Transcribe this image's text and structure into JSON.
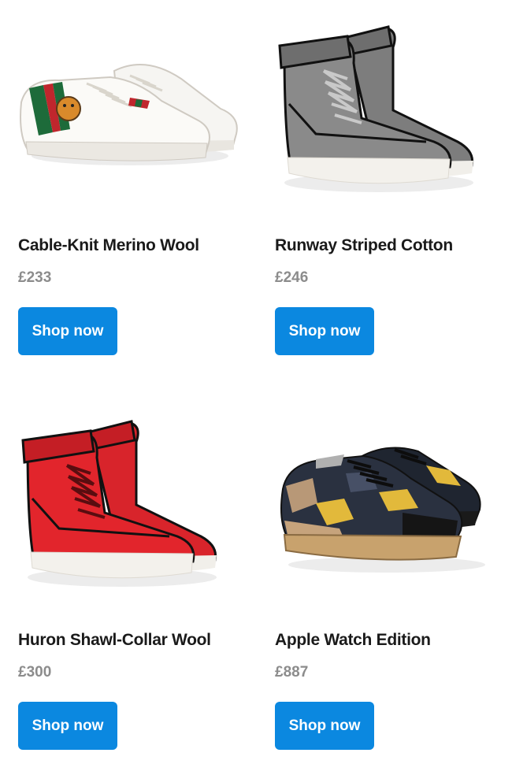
{
  "colors": {
    "button_bg": "#0b88e0",
    "button_text": "#ffffff",
    "name_text": "#1a1a1a",
    "price_text": "#8c8c8c"
  },
  "products": [
    {
      "name": "Cable-Knit Merino Wool",
      "price": "£233",
      "button_label": "Shop now",
      "image_icon": "white-low-top-sneaker-image"
    },
    {
      "name": "Runway Striped Cotton",
      "price": "£246",
      "button_label": "Shop now",
      "image_icon": "grey-high-top-sneaker-image"
    },
    {
      "name": "Huron Shawl-Collar Wool",
      "price": "£300",
      "button_label": "Shop now",
      "image_icon": "red-high-top-sneaker-image"
    },
    {
      "name": "Apple Watch Edition",
      "price": "£887",
      "button_label": "Shop now",
      "image_icon": "camo-sneaker-image"
    }
  ]
}
